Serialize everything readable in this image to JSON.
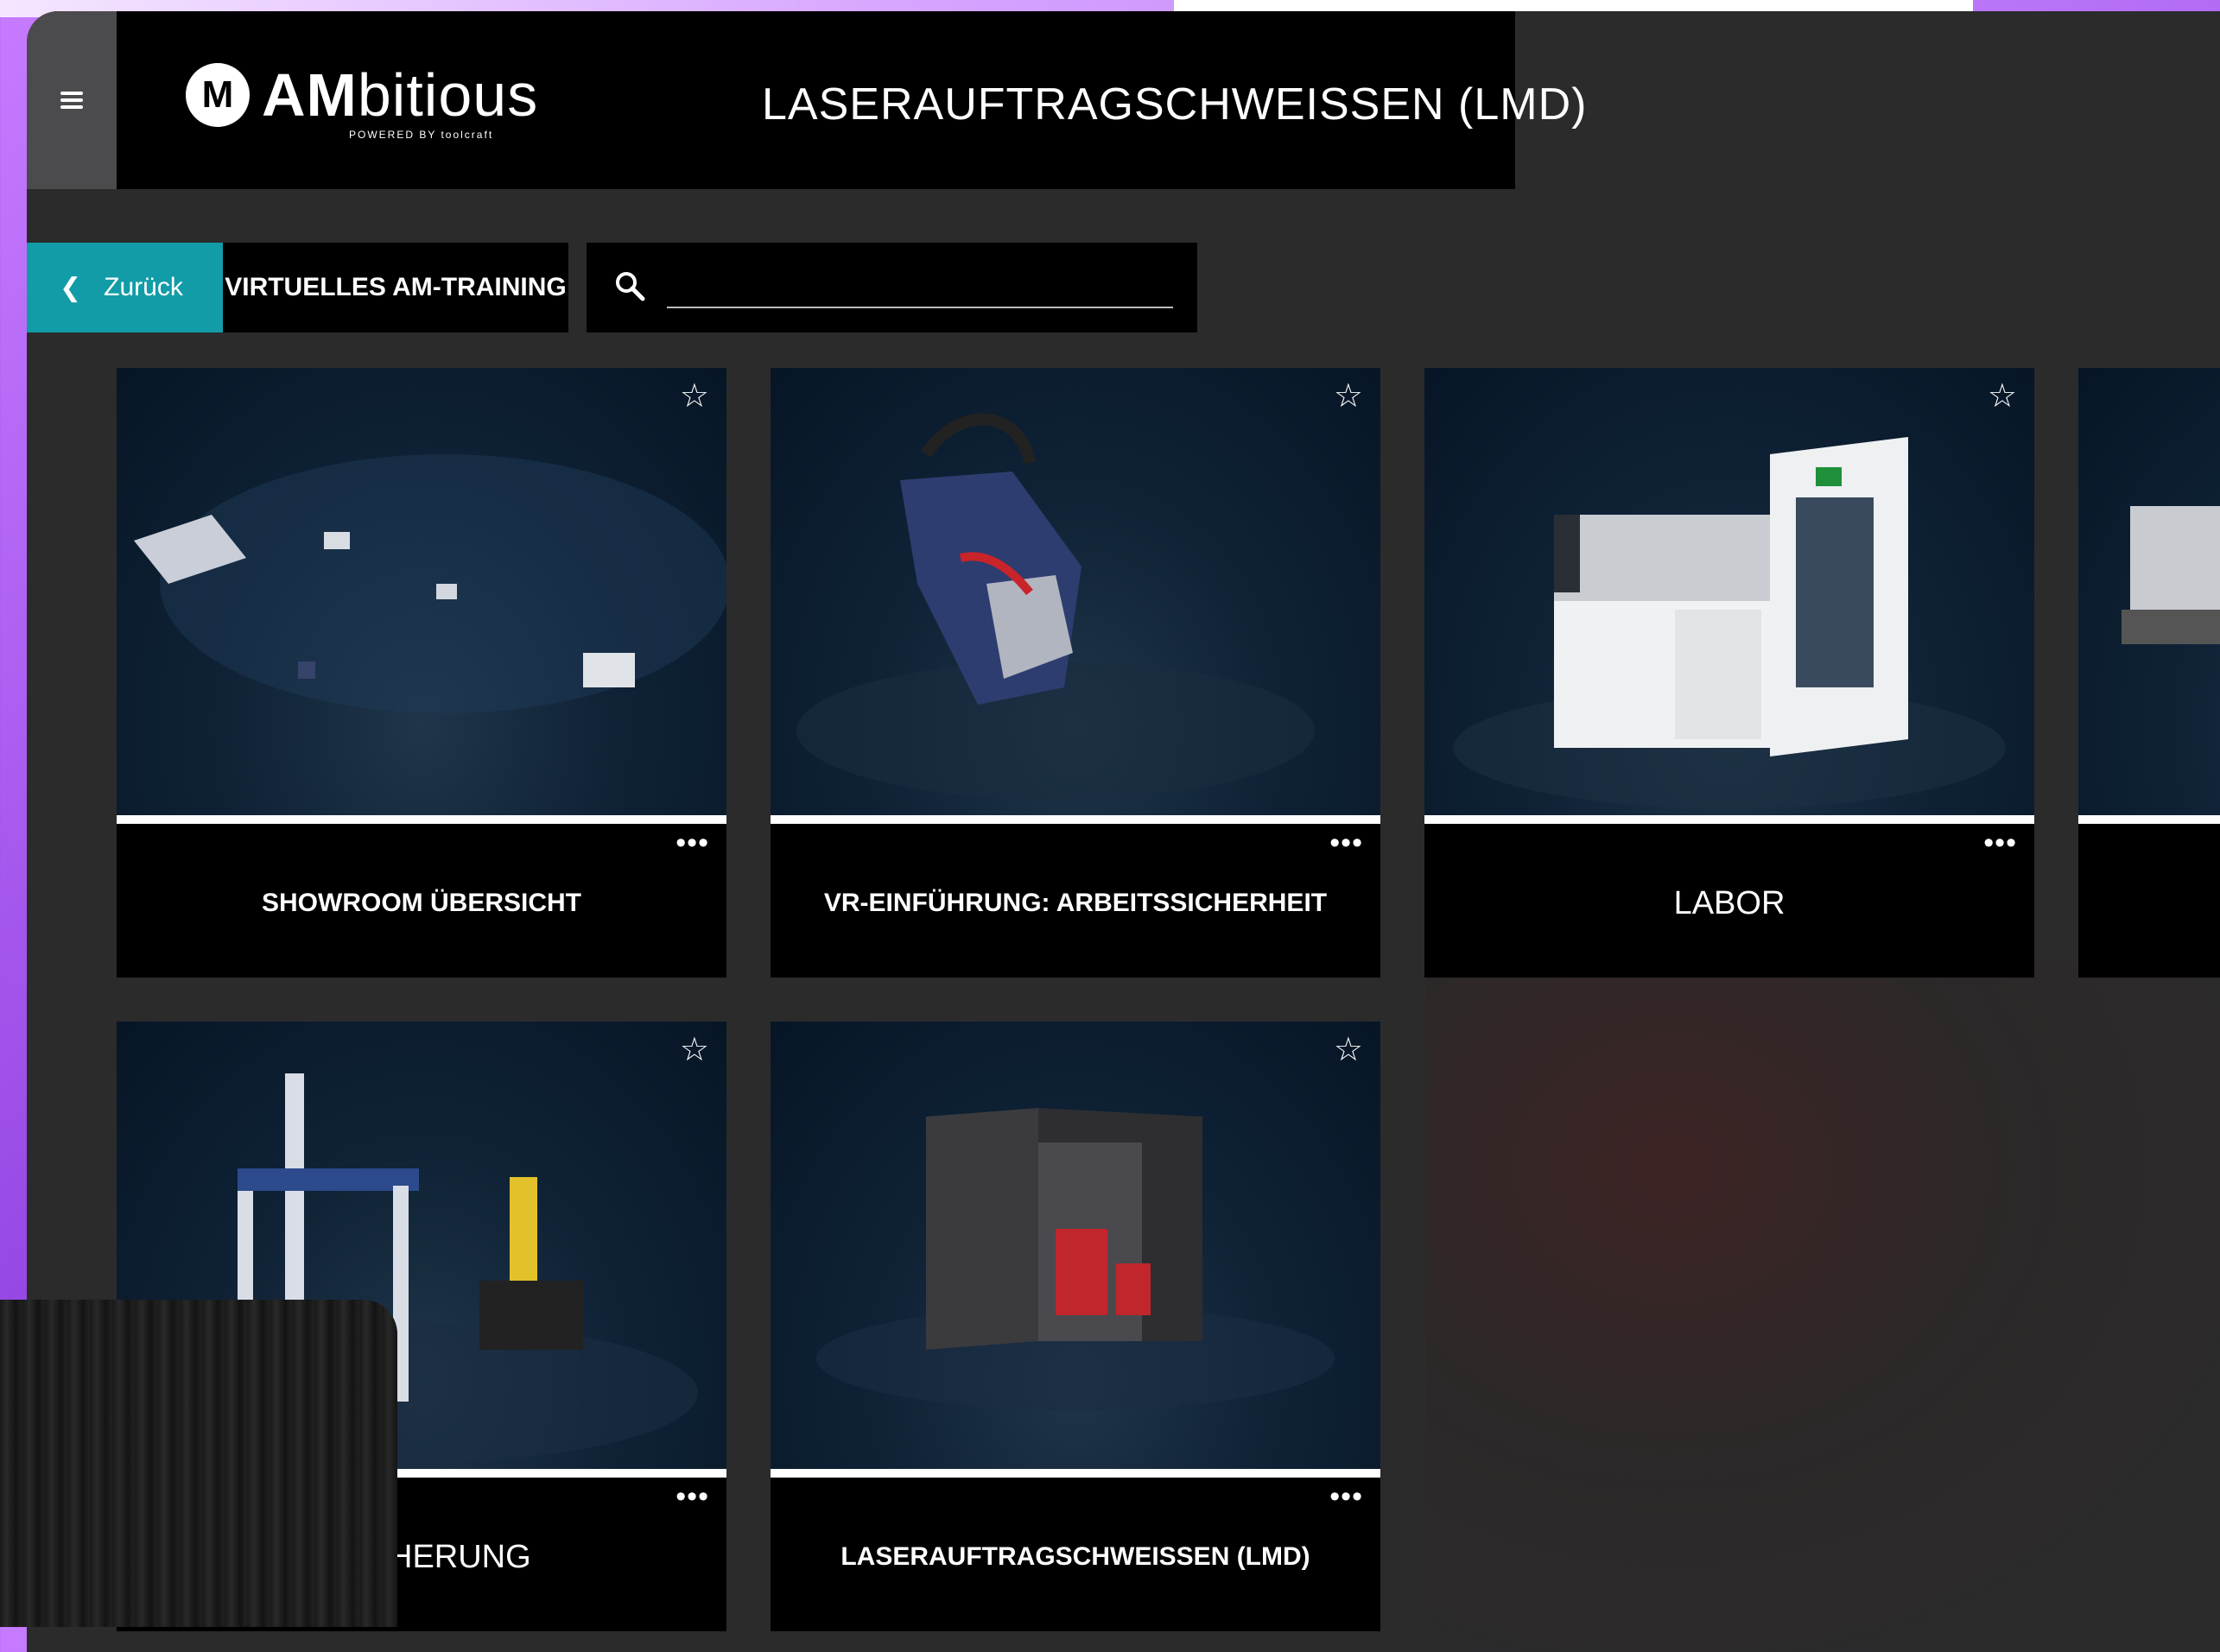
{
  "app": {
    "title": "LASERAUFTRAGSCHWEISSEN (LMD)",
    "brand": "AMbitious",
    "brand_bold": "AM",
    "brand_rest": "bitious",
    "brand_sub": "POWERED BY toolcraft"
  },
  "nav": {
    "back_label": "Zurück",
    "breadcrumb": "VIRTUELLES AM-TRAINING"
  },
  "search": {
    "placeholder": ""
  },
  "cards": [
    {
      "title": "SHOWROOM ÜBERSICHT"
    },
    {
      "title": "VR-EINFÜHRUNG: ARBEITSSICHERHEIT"
    },
    {
      "title": "LABOR"
    },
    {
      "title": "SSICHERUNG"
    },
    {
      "title": "LASERAUFTRAGSCHWEISSEN (LMD)"
    }
  ],
  "colors": {
    "accent": "#129ca8",
    "background": "#2b2b2c",
    "topbar": "#000000"
  }
}
